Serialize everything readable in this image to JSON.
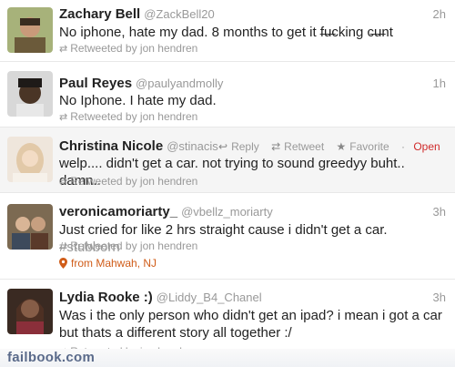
{
  "tweets": [
    {
      "name": "Zachary Bell",
      "handle": "@ZackBell20",
      "time": "2h",
      "text": "No iphone, hate my dad. 8 months to get it f̶u̶cking c̶u̶nt",
      "retweeted": "Retweeted by jon hendren"
    },
    {
      "name": "Paul Reyes",
      "handle": "@paulyandmolly",
      "time": "1h",
      "text": "No Iphone. I hate my dad.",
      "retweeted": "Retweeted by jon hendren"
    },
    {
      "name": "Christina Nicole",
      "handle": "@stinacis",
      "text": "welp.... didn't get a car. not trying to sound greedyy buht.. damn..",
      "retweeted": "Retweeted by jon hendren",
      "actions": {
        "reply": "Reply",
        "retweet": "Retweet",
        "favorite": "Favorite",
        "open": "Open"
      }
    },
    {
      "name": "veronicamoriarty_",
      "handle": "@vbellz_moriarty",
      "time": "3h",
      "text": "Just cried for like 2 hrs straight cause i didn't get a car.",
      "hashtag": "#stubborn",
      "retweeted": "Retweeted by jon hendren",
      "location": "from Mahwah, NJ"
    },
    {
      "name": "Lydia Rooke :)",
      "handle": "@Liddy_B4_Chanel",
      "time": "3h",
      "text": "Was i the only person who didn't get an ipad? i mean i got a car but thats a different story all together :/",
      "retweeted": "Retweeted by jon hendren"
    }
  ],
  "watermark": "failbook.com",
  "icons": {
    "retweet": "retweet-icon",
    "reply": "reply-icon",
    "favorite": "star-icon",
    "location": "pin-icon"
  },
  "colors": {
    "location": "#d05c18",
    "open": "#d02b2b",
    "watermark": "#5a6a8a"
  }
}
